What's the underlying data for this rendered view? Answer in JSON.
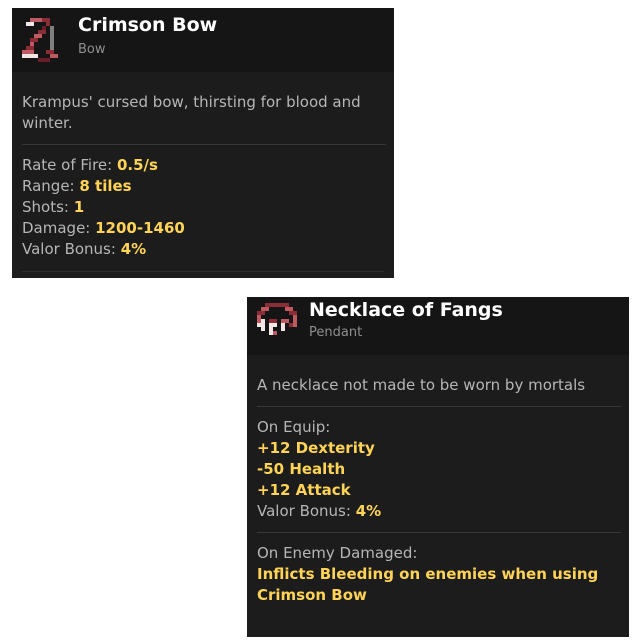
{
  "colors": {
    "panel_bg": "#1c1c1c",
    "header_bg": "#151515",
    "title_text": "#ffffff",
    "body_text": "#b6b6b6",
    "highlight_text": "#ffd456"
  },
  "bow": {
    "icon": "crimson-bow-icon",
    "name": "Crimson Bow",
    "type": "Bow",
    "description": "Krampus' cursed bow, thirsting for blood and winter.",
    "stats": [
      {
        "label": "Rate of Fire: ",
        "value": "0.5/s"
      },
      {
        "label": "Range: ",
        "value": "8 tiles"
      },
      {
        "label": "Shots: ",
        "value": "1"
      },
      {
        "label": "Damage: ",
        "value": "1200-1460"
      },
      {
        "label": "Valor Bonus: ",
        "value": "4%"
      }
    ]
  },
  "necklace": {
    "icon": "necklace-of-fangs-icon",
    "name": "Necklace of Fangs",
    "type": "Pendant",
    "description": "A necklace not made to be worn by mortals",
    "on_equip_label": "On Equip:",
    "bonuses": [
      "+12 Dexterity",
      "-50 Health",
      "+12 Attack"
    ],
    "valor_label": "Valor Bonus: ",
    "valor_value": "4%",
    "on_enemy_damaged_label": "On Enemy Damaged:",
    "effect": "Inflicts Bleeding on enemies when using Crimson Bow"
  }
}
